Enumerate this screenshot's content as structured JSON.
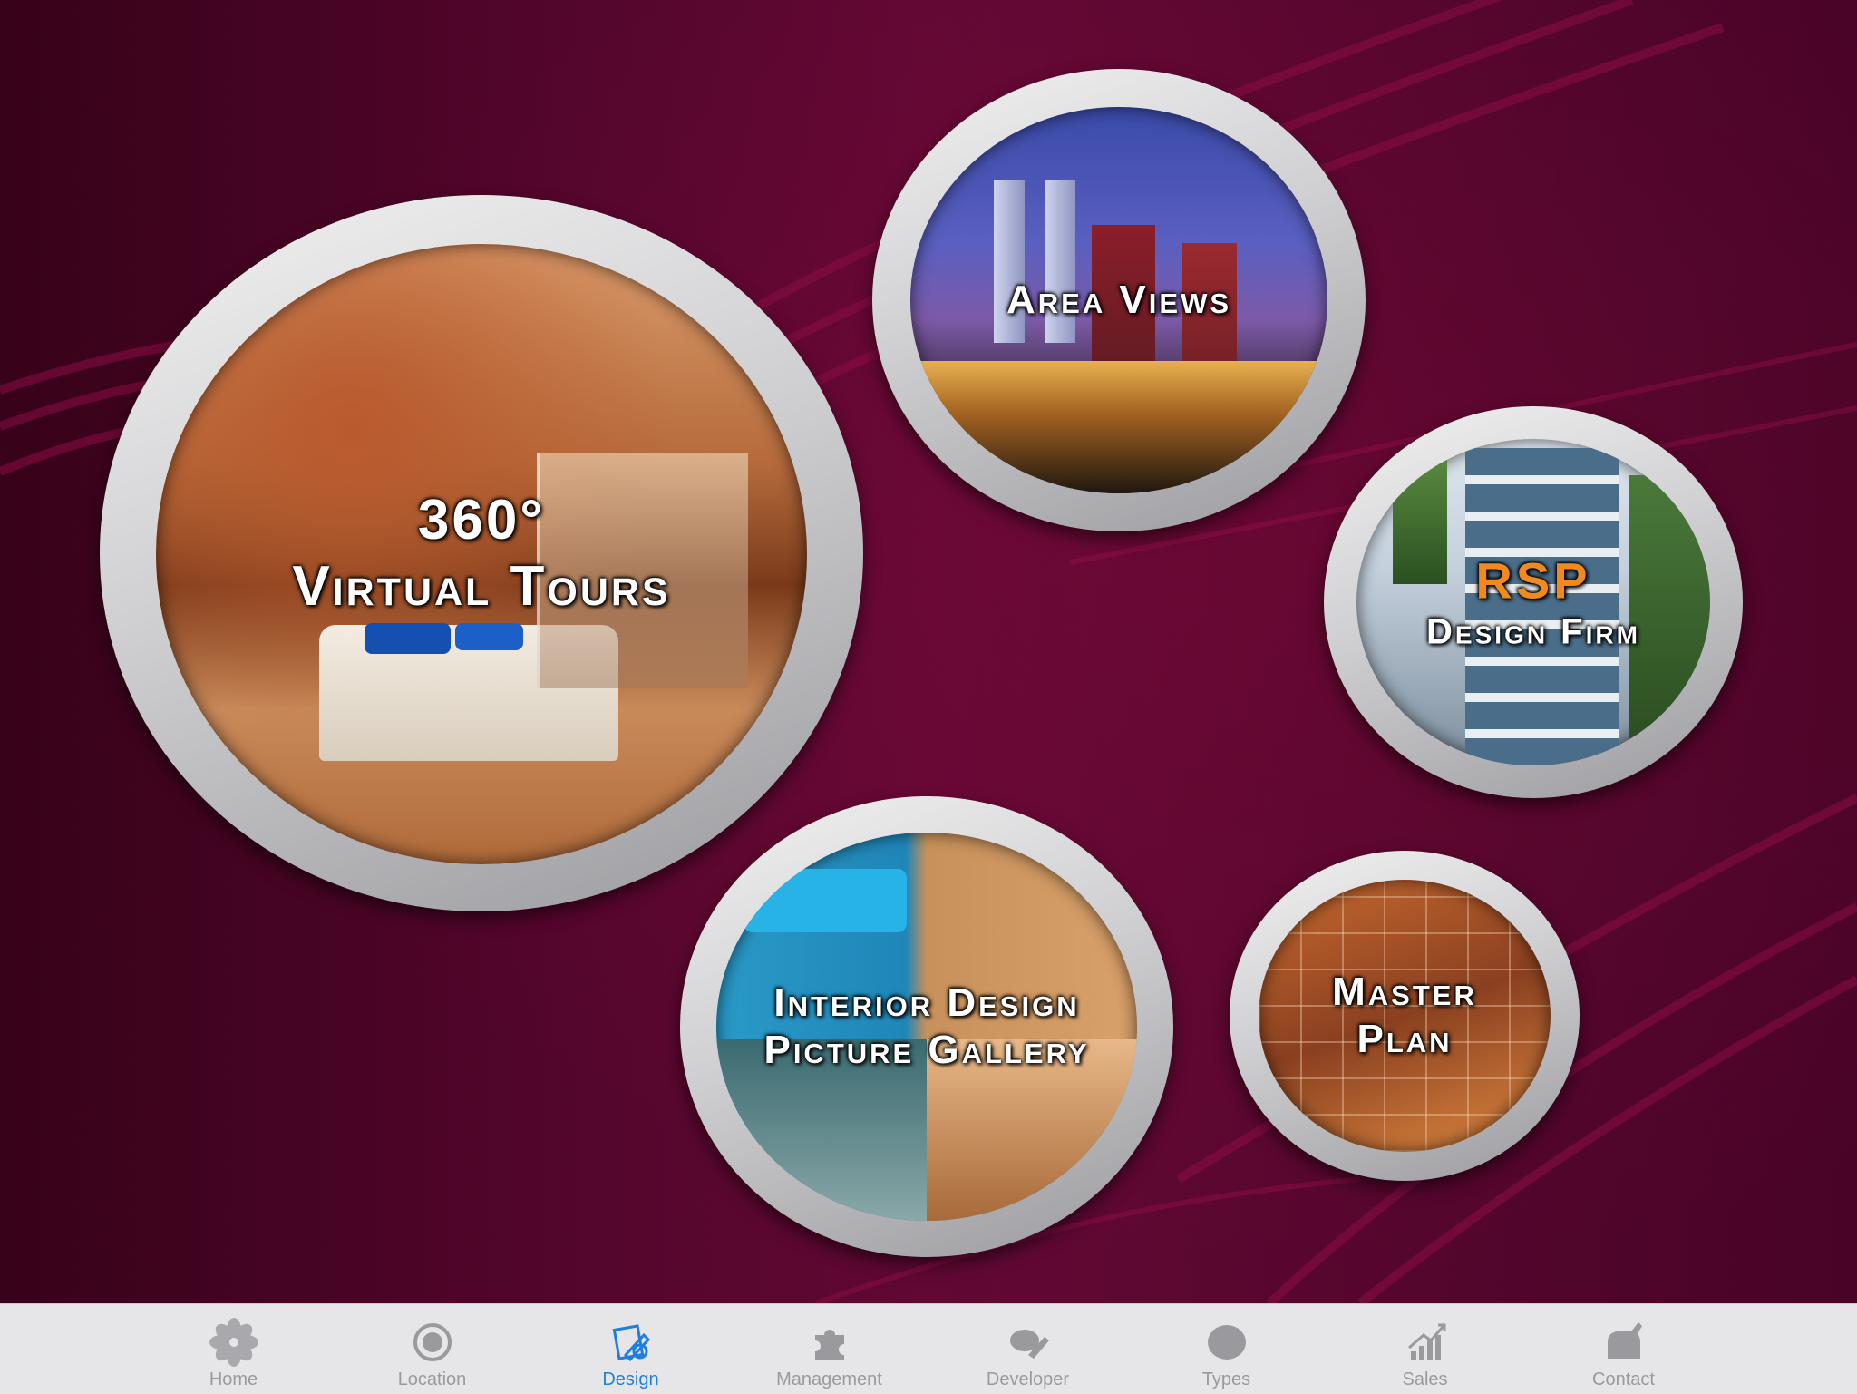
{
  "tiles": {
    "virtual_tours": {
      "line1": "360°",
      "line2": "Virtual Tours"
    },
    "area_views": {
      "label": "Area Views"
    },
    "design_firm": {
      "brand": "RSP",
      "label": "Design Firm"
    },
    "interior_gallery": {
      "line1": "Interior Design",
      "line2": "Picture Gallery"
    },
    "master_plan": {
      "line1": "Master",
      "line2": "Plan"
    }
  },
  "tabbar": {
    "active": "Design",
    "tabs": [
      {
        "label": "Home",
        "icon": "flower-icon"
      },
      {
        "label": "Location",
        "icon": "target-icon"
      },
      {
        "label": "Design",
        "icon": "design-pencil-icon"
      },
      {
        "label": "Management",
        "icon": "puzzle-icon"
      },
      {
        "label": "Developer",
        "icon": "developer-icon"
      },
      {
        "label": "Types",
        "icon": "circle-icon"
      },
      {
        "label": "Sales",
        "icon": "sales-chart-icon"
      },
      {
        "label": "Contact",
        "icon": "contact-icon"
      }
    ]
  },
  "colors": {
    "background": "#5c0630",
    "accent_brand": "#f08a1e",
    "tab_active": "#1f7fdc",
    "tab_inactive": "#9a9a9e"
  }
}
